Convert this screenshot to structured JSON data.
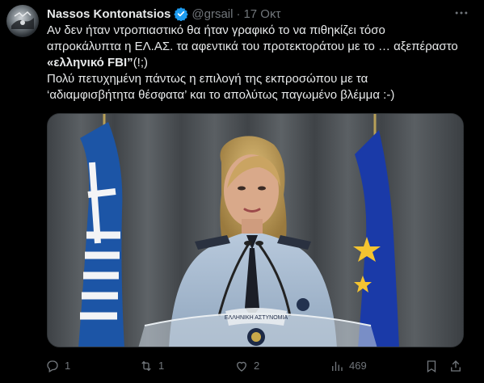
{
  "tweet": {
    "author_name": "Nassos Kontonatsios",
    "handle": "@grsail",
    "separator": "·",
    "date": "17 Οκτ",
    "more_icon": "more-horizontal-icon",
    "verified_icon": "verified-badge-icon",
    "verified_color": "#1d9bf0",
    "text_line1": "Αν δεν ήταν ντροπιαστικό θα ήταν γραφικό το να πιθηκίζει τόσο",
    "text_line2": "απροκάλυπτα η ΕΛ.ΑΣ. τα αφεντικά του προτεκτοράτου με το … αξεπέραστο",
    "text_line3_bold": "«ελληνικό FBI”",
    "text_line3_rest": "(!;)",
    "text_line4": "Πολύ πετυχημένη πάντως η επιλογή της εκπροσώπου με τα",
    "text_line5": "‘αδιαμφισβήτητα θέσφατα’ και το απολύτως παγωμένο βλέμμα :-)"
  },
  "media": {
    "description_icon": "photo-press-conference",
    "podium_text": "ΕΛΛΗΝΙΚΗ ΑΣΤΥΝΟΜΙΑ"
  },
  "actions": {
    "reply": {
      "icon": "reply-icon",
      "count": "1"
    },
    "retweet": {
      "icon": "retweet-icon",
      "count": "1"
    },
    "like": {
      "icon": "heart-icon",
      "count": "2"
    },
    "views": {
      "icon": "views-icon",
      "count": "469"
    },
    "bookmark": {
      "icon": "bookmark-icon"
    },
    "share": {
      "icon": "share-icon"
    }
  },
  "colors": {
    "background": "#000000",
    "text_primary": "#e7e9ea",
    "text_secondary": "#71767b",
    "accent": "#1d9bf0"
  }
}
